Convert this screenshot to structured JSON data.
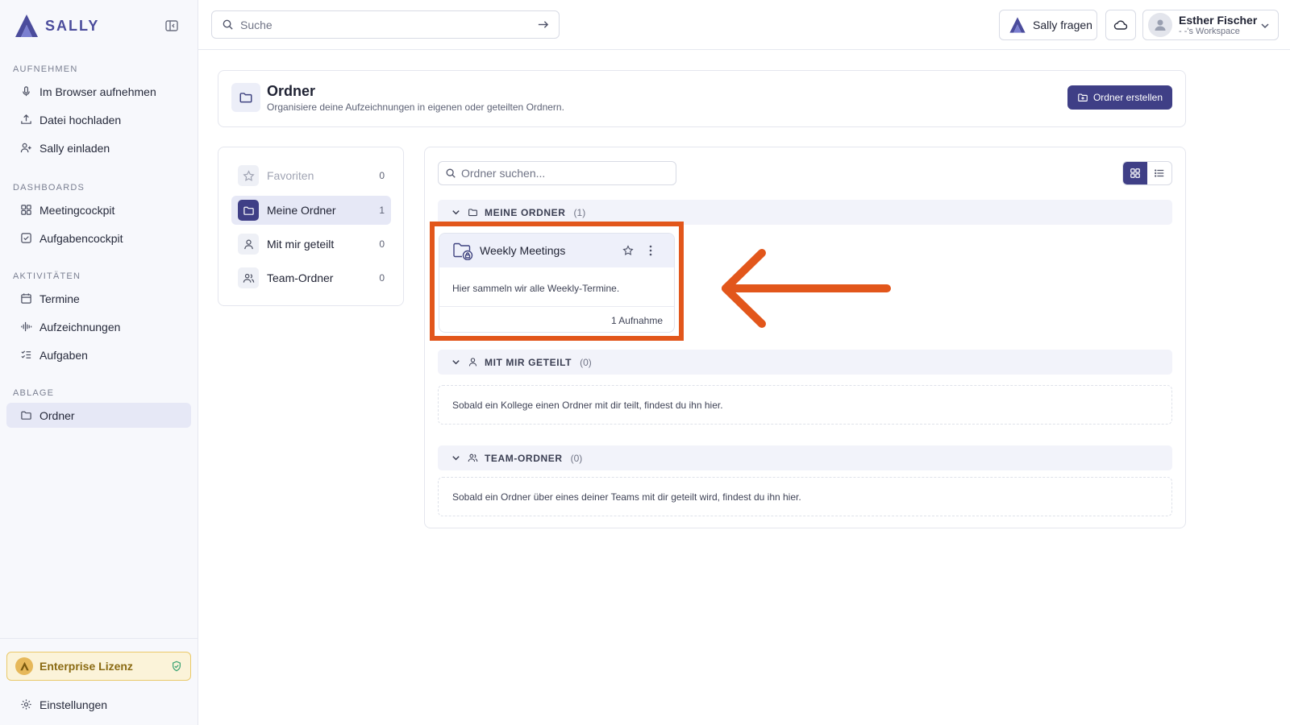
{
  "app": {
    "name": "SALLY"
  },
  "colors": {
    "accent": "#3f3f86",
    "annotation": "#e2561b",
    "license_bg": "#fbf3d9"
  },
  "sidebar": {
    "sections": [
      {
        "title": "AUFNEHMEN",
        "items": [
          {
            "label": "Im Browser aufnehmen",
            "icon": "microphone-icon"
          },
          {
            "label": "Datei hochladen",
            "icon": "upload-icon"
          },
          {
            "label": "Sally einladen",
            "icon": "user-plus-icon"
          }
        ]
      },
      {
        "title": "DASHBOARDS",
        "items": [
          {
            "label": "Meetingcockpit",
            "icon": "grid-icon"
          },
          {
            "label": "Aufgabencockpit",
            "icon": "checkbox-icon"
          }
        ]
      },
      {
        "title": "AKTIVITÄTEN",
        "items": [
          {
            "label": "Termine",
            "icon": "calendar-icon"
          },
          {
            "label": "Aufzeichnungen",
            "icon": "waveform-icon"
          },
          {
            "label": "Aufgaben",
            "icon": "checklist-icon"
          }
        ]
      },
      {
        "title": "ABLAGE",
        "items": [
          {
            "label": "Ordner",
            "icon": "folder-icon",
            "active": true
          }
        ]
      }
    ],
    "license": "Enterprise Lizenz",
    "settings": "Einstellungen"
  },
  "topbar": {
    "search_placeholder": "Suche",
    "ask_label": "Sally fragen",
    "user_name": "Esther Fischer",
    "user_workspace": "- -'s Workspace"
  },
  "page": {
    "title": "Ordner",
    "subtitle": "Organisiere deine Aufzeichnungen in eigenen oder geteilten Ordnern.",
    "create_label": "Ordner erstellen"
  },
  "filters": [
    {
      "label": "Favoriten",
      "count": "0",
      "icon": "star-icon"
    },
    {
      "label": "Meine Ordner",
      "count": "1",
      "icon": "folder-icon",
      "active": true
    },
    {
      "label": "Mit mir geteilt",
      "count": "0",
      "icon": "user-icon"
    },
    {
      "label": "Team-Ordner",
      "count": "0",
      "icon": "users-icon"
    }
  ],
  "main": {
    "folder_search_placeholder": "Ordner suchen...",
    "sections": [
      {
        "label": "MEINE ORDNER",
        "count": "(1)"
      },
      {
        "label": "MIT MIR GETEILT",
        "count": "(0)",
        "empty_text": "Sobald ein Kollege einen Ordner mit dir teilt, findest du ihn hier."
      },
      {
        "label": "TEAM-ORDNER",
        "count": "(0)",
        "empty_text": "Sobald ein Ordner über eines deiner Teams mit dir geteilt wird, findest du ihn hier."
      }
    ],
    "folder": {
      "title": "Weekly Meetings",
      "description": "Hier sammeln wir alle Weekly-Termine.",
      "count": "1 Aufnahme"
    }
  }
}
